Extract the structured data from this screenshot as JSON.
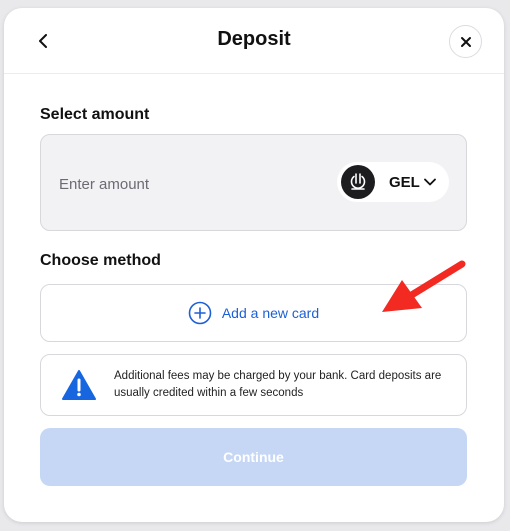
{
  "header": {
    "title": "Deposit",
    "back_icon": "chevron-left-icon",
    "close_icon": "close-icon"
  },
  "amount": {
    "section_label": "Select amount",
    "placeholder": "Enter amount",
    "currency_code": "GEL",
    "currency_icon": "lari-coin-icon"
  },
  "method": {
    "section_label": "Choose method",
    "add_card_label": "Add a new card",
    "add_icon": "plus-circle-icon"
  },
  "notice": {
    "text": "Additional fees may be charged by your bank. Card deposits are usually credited within a few seconds",
    "icon": "warning-triangle-icon"
  },
  "continue_label": "Continue",
  "colors": {
    "accent": "#1d5fd6",
    "continue_disabled": "#c6d7f6",
    "annotation_arrow": "#f22a22"
  }
}
